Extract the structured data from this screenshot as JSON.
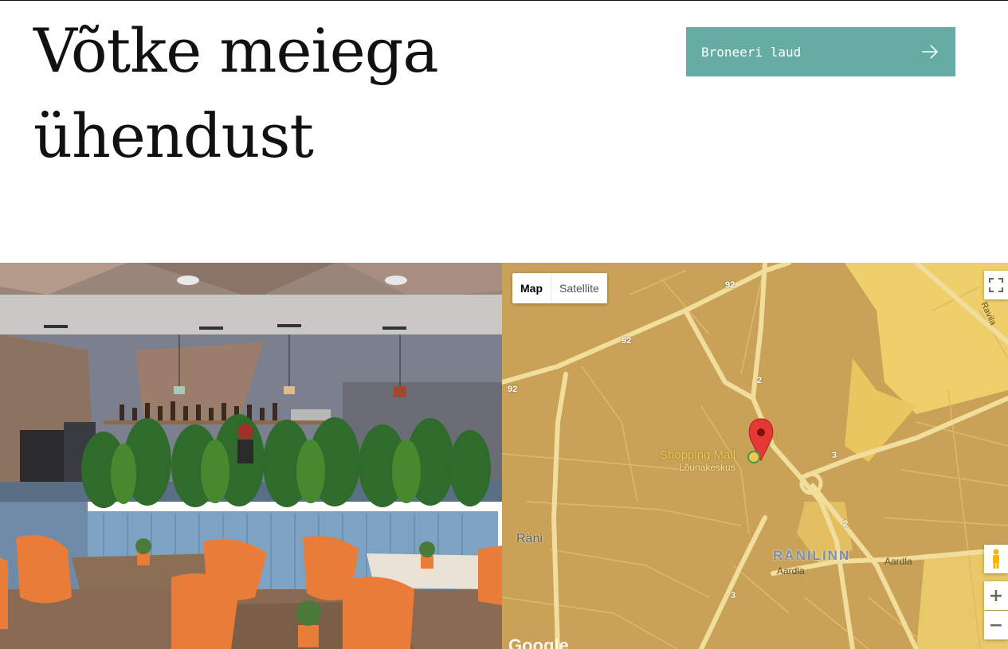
{
  "page": {
    "heading_line1": "Võtke meiega",
    "heading_line2": "ühendust"
  },
  "cta": {
    "label": "Broneeri laud",
    "icon": "arrow-right-icon",
    "color": "#65ada3"
  },
  "map": {
    "type_map": "Map",
    "type_satellite": "Satellite",
    "poi_name": "Shopping Mall",
    "poi_sub": "Lõunakeskus",
    "district": "RÄNILINN",
    "area": "Räni",
    "street_aardla_1": "Aardla",
    "street_aardla_2": "Aardla",
    "street_ravila": "Ravila",
    "road_92a": "92",
    "road_92b": "92",
    "road_92c": "92",
    "road_2a": "2",
    "road_2b": "2",
    "road_3a": "3",
    "road_3b": "3",
    "zoom_in": "+",
    "zoom_out": "−",
    "logo": "Google",
    "colors": {
      "land": "#c9a257",
      "road": "#f1dd9c",
      "highlight": "#efcf6a",
      "pin": "#e53935"
    }
  }
}
